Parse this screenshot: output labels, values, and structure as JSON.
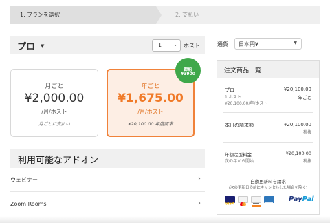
{
  "steps": {
    "step1": "1. プランを選択",
    "step2": "2. 支払い"
  },
  "plan": {
    "name": "プロ",
    "quantity": "1",
    "quantity_unit": "ホスト"
  },
  "pricing": {
    "monthly": {
      "period": "月ごと",
      "price": "¥2,000.00",
      "unit": "/月/ホスト",
      "note": "月ごとに支払い"
    },
    "yearly": {
      "period": "年ごと",
      "price": "¥1,675.00",
      "unit": "/月/ホスト",
      "note": "¥20,100.00 年度請求"
    },
    "savings_badge": {
      "line1": "節約",
      "line2": "¥3900"
    },
    "selected": "yearly"
  },
  "addons": {
    "title": "利用可能なアドオン",
    "items": [
      {
        "label": "ウェビナー"
      },
      {
        "label": "Zoom Rooms"
      }
    ]
  },
  "currency": {
    "label": "通貨",
    "value": "日本円¥"
  },
  "summary": {
    "title": "注文商品一覧",
    "item": {
      "name": "プロ",
      "hosts": "1 ホスト",
      "detail": "¥20,100.00/年/ホスト",
      "price": "¥20,100.00",
      "period": "年ごと"
    },
    "today": {
      "label": "本日の請求額",
      "amount": "¥20,100.00",
      "tax": "税抜"
    },
    "recurring": {
      "label": "年額定型料金",
      "sub": "次の年から開始",
      "amount": "¥20,100.00",
      "tax": "税抜"
    },
    "renewal": {
      "title": "自動更新料を請求",
      "sub": "(次の更新日の前にキャンセルした場合を除く)"
    },
    "payment_methods": [
      "visa",
      "mastercard",
      "discover",
      "amex",
      "paypal"
    ],
    "paypal_text": {
      "pay": "Pay",
      "pal": "Pal"
    }
  },
  "colors": {
    "accent_orange": "#f07a28",
    "savings_green": "#3fa84a",
    "panel_gray": "#f0f0f0"
  }
}
